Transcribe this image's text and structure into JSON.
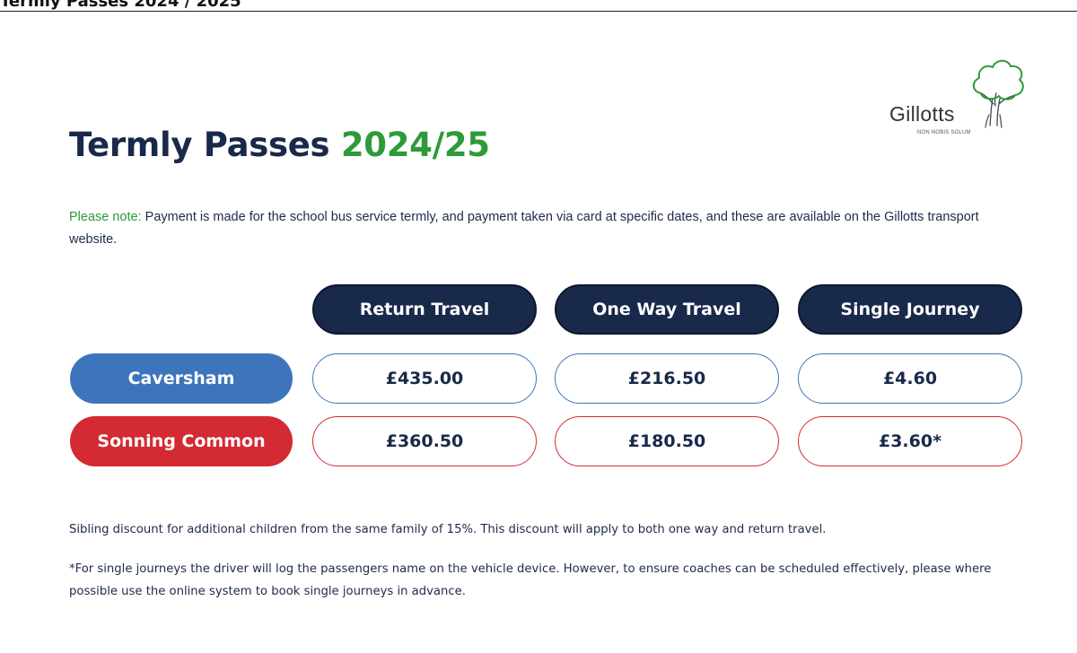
{
  "topbar": {
    "title": "Termly Passes 2024 / 2025"
  },
  "logo": {
    "name": "Gillotts",
    "motto": "NON NOBIS SOLUM",
    "icon": "tree-icon"
  },
  "heading": {
    "title_prefix": "Termly Passes ",
    "title_year": "2024/25"
  },
  "note": {
    "label": "Please note:",
    "text": " Payment is made for the school bus service termly, and payment taken via card at specific dates, and these are available on the Gillotts transport website."
  },
  "fares": {
    "columns": [
      "Return Travel",
      "One Way Travel",
      "Single Journey"
    ],
    "rows": [
      {
        "label": "Caversham",
        "color": "#3d75bd",
        "prices": [
          "£435.00",
          "£216.50",
          "£4.60"
        ]
      },
      {
        "label": "Sonning Common",
        "color": "#d42a33",
        "prices": [
          "£360.50",
          "£180.50",
          "£3.60*"
        ]
      }
    ]
  },
  "footnotes": {
    "sibling": "Sibling discount for additional children from the same family of 15%. This discount will apply to both one way and return travel.",
    "single": "*For single journeys the driver will log the passengers name on the vehicle device. However, to ensure coaches can be scheduled effectively, please where possible use the online system to book single journeys in advance."
  },
  "colors": {
    "navy": "#18294a",
    "green": "#2e9a3a",
    "blue": "#3d75bd",
    "red": "#d42a33"
  }
}
